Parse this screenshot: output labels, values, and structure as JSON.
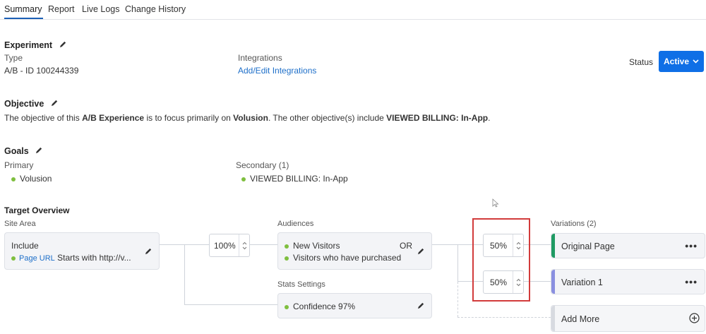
{
  "tabs": [
    {
      "label": "Summary"
    },
    {
      "label": "Report"
    },
    {
      "label": "Live Logs"
    },
    {
      "label": "Change History"
    }
  ],
  "experiment": {
    "heading": "Experiment",
    "type_label": "Type",
    "type_value": "A/B - ID 100244339",
    "integrations_label": "Integrations",
    "integrations_link": "Add/Edit Integrations",
    "status_label": "Status",
    "status_value": "Active"
  },
  "objective": {
    "heading": "Objective",
    "text_1": "The objective of this ",
    "text_2": "A/B Experience",
    "text_3": " is to focus primarily on ",
    "text_4": "Volusion",
    "text_5": ". The other objective(s) include ",
    "text_6": "VIEWED BILLING: In-App",
    "text_7": "."
  },
  "goals": {
    "heading": "Goals",
    "primary_label": "Primary",
    "primary_value": "Volusion",
    "secondary_label": "Secondary (1)",
    "secondary_value": "VIEWED BILLING: In-App"
  },
  "target": {
    "heading": "Target Overview",
    "site_area_label": "Site Area",
    "site_include": "Include",
    "site_rule_tag": "Page URL",
    "site_rule_text": "Starts with http://v...",
    "site_percent": "100%",
    "audiences_label": "Audiences",
    "audience_1": "New Visitors",
    "audience_op": "OR",
    "audience_2": "Visitors who have purchased",
    "stats_label": "Stats Settings",
    "stats_value": "Confidence 97%",
    "split_1": "50%",
    "split_2": "50%",
    "variations_label": "Variations (2)",
    "variations": [
      {
        "name": "Original Page",
        "color": "#1f9a63"
      },
      {
        "name": "Variation 1",
        "color": "#8a8fe0"
      }
    ],
    "add_more": "Add More"
  },
  "colors": {
    "accent": "#0f6fe6",
    "highlight": "#d23b3b",
    "dot": "#7fbf3f"
  }
}
